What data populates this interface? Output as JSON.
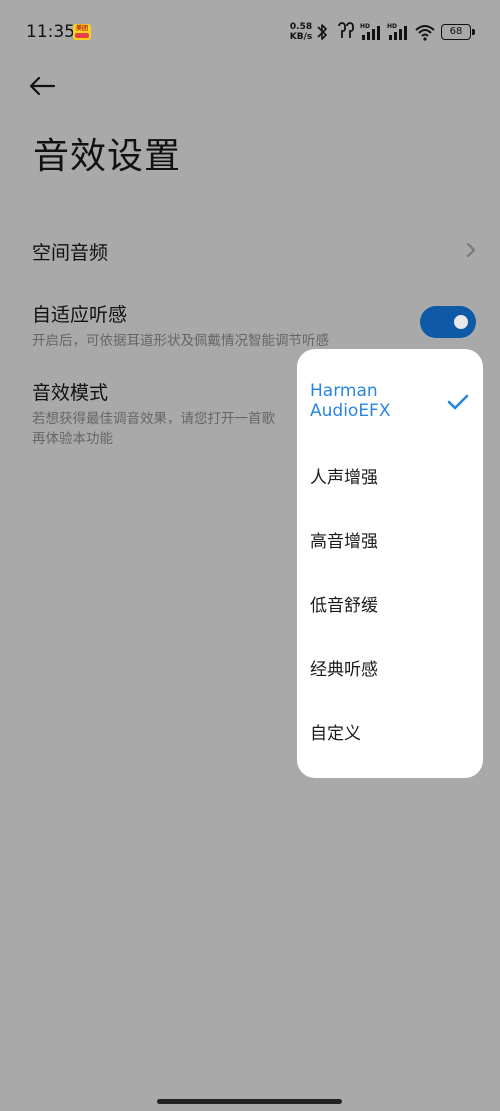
{
  "status_bar": {
    "time": "11:35",
    "app_badge_text": "美团",
    "net_speed_value": "0.58",
    "net_speed_unit": "KB/s",
    "battery": "68",
    "signal_label_1": "HD",
    "signal_label_2": "HD"
  },
  "header": {
    "back_icon": "arrow-left-icon",
    "title": "音效设置"
  },
  "settings": {
    "spatial_audio": {
      "title": "空间音频"
    },
    "adaptive_listening": {
      "title": "自适应听感",
      "description": "开启后，可依据耳道形状及佩戴情况智能调节听感",
      "enabled": true
    },
    "sound_mode": {
      "title": "音效模式",
      "description_line1": "若想获得最佳调音效果，请您打开一首歌",
      "description_line2": "再体验本功能"
    }
  },
  "dropdown": {
    "items": [
      {
        "label_line1": "Harman",
        "label_line2": "AudioEFX",
        "selected": true
      },
      {
        "label": "人声增强",
        "selected": false
      },
      {
        "label": "高音增强",
        "selected": false
      },
      {
        "label": "低音舒缓",
        "selected": false
      },
      {
        "label": "经典听感",
        "selected": false
      },
      {
        "label": "自定义",
        "selected": false
      }
    ]
  },
  "colors": {
    "background_dim": "#a9a9a9",
    "accent": "#2a85e0",
    "toggle_on": "#0e5aa6"
  }
}
